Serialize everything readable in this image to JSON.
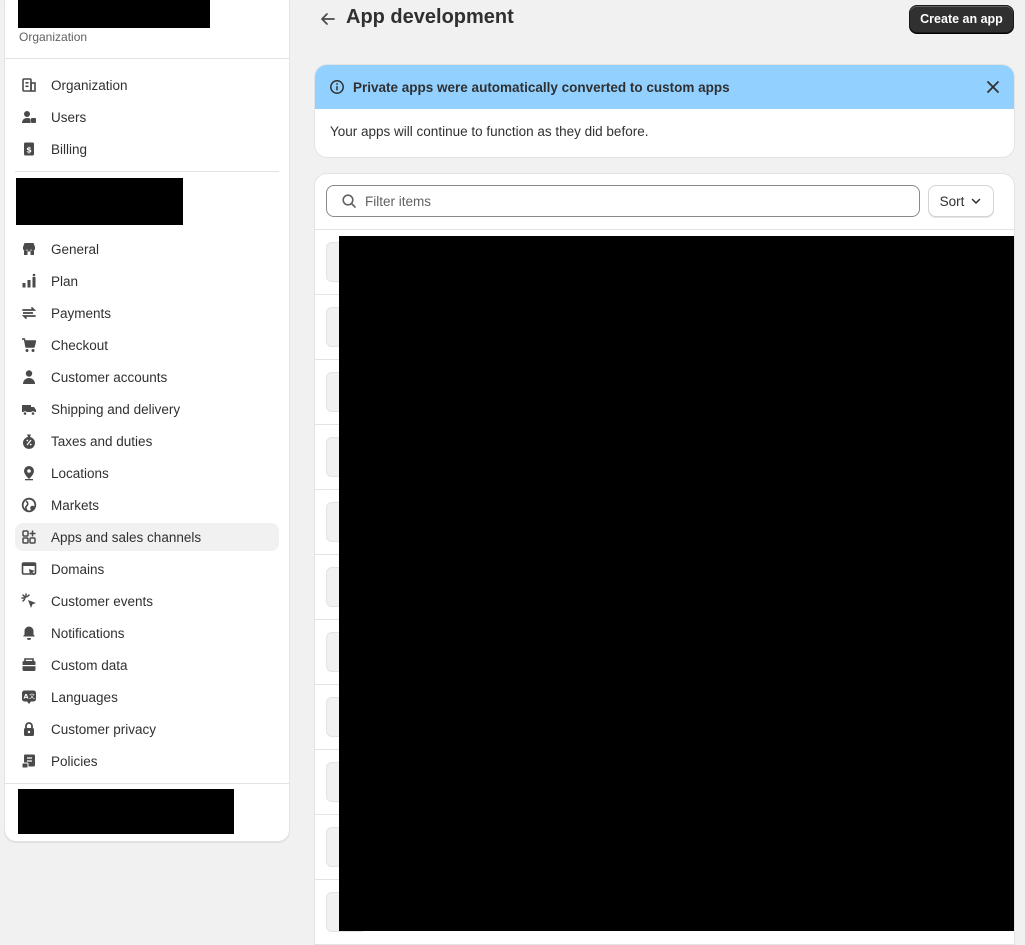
{
  "sidebar": {
    "org_label": "Organization",
    "org_items": [
      {
        "label": "Organization",
        "icon": "organization-icon"
      },
      {
        "label": "Users",
        "icon": "users-icon"
      },
      {
        "label": "Billing",
        "icon": "billing-icon"
      }
    ],
    "store_items": [
      {
        "label": "General",
        "icon": "store-icon"
      },
      {
        "label": "Plan",
        "icon": "plan-icon"
      },
      {
        "label": "Payments",
        "icon": "payments-icon"
      },
      {
        "label": "Checkout",
        "icon": "cart-icon"
      },
      {
        "label": "Customer accounts",
        "icon": "person-icon"
      },
      {
        "label": "Shipping and delivery",
        "icon": "truck-icon"
      },
      {
        "label": "Taxes and duties",
        "icon": "tax-icon"
      },
      {
        "label": "Locations",
        "icon": "location-icon"
      },
      {
        "label": "Markets",
        "icon": "globe-icon"
      },
      {
        "label": "Apps and sales channels",
        "icon": "apps-icon"
      },
      {
        "label": "Domains",
        "icon": "domain-icon"
      },
      {
        "label": "Customer events",
        "icon": "cursor-click-icon"
      },
      {
        "label": "Notifications",
        "icon": "bell-icon"
      },
      {
        "label": "Custom data",
        "icon": "database-icon"
      },
      {
        "label": "Languages",
        "icon": "language-icon"
      },
      {
        "label": "Customer privacy",
        "icon": "lock-icon"
      },
      {
        "label": "Policies",
        "icon": "policy-icon"
      }
    ],
    "active_item": "Apps and sales channels"
  },
  "header": {
    "title": "App development",
    "create_button": "Create an app"
  },
  "banner": {
    "title": "Private apps were automatically converted to custom apps",
    "body": "Your apps will continue to function as they did before."
  },
  "apps_list": {
    "filter_placeholder": "Filter items",
    "sort_label": "Sort",
    "row_count": 11
  },
  "colors": {
    "banner_bg": "#91d0ff",
    "primary_button": "#303030",
    "page_bg": "#f1f1f1"
  }
}
